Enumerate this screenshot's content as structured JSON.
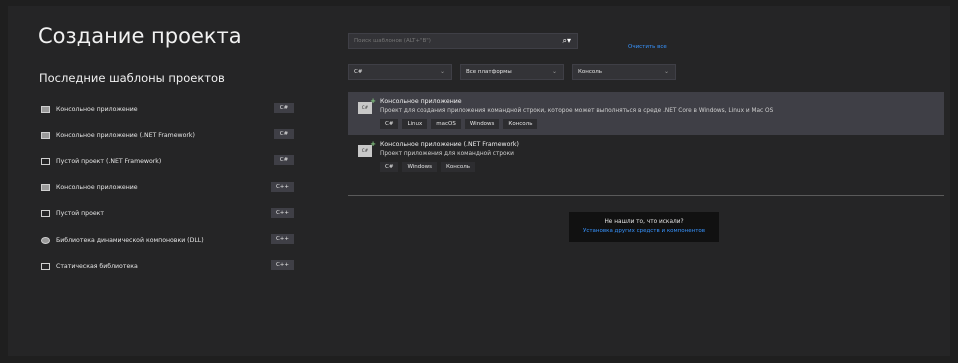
{
  "title": "Создание проекта",
  "recent": {
    "header": "Последние шаблоны проектов",
    "items": [
      {
        "label": "Консольное приложение",
        "tag": "C#",
        "icon": "console-app-icon"
      },
      {
        "label": "Консольное приложение (.NET Framework)",
        "tag": "C#",
        "icon": "console-app-icon"
      },
      {
        "label": "Пустой проект (.NET Framework)",
        "tag": "C#",
        "icon": "empty-project-icon"
      },
      {
        "label": "Консольное приложение",
        "tag": "C++",
        "icon": "console-app-icon"
      },
      {
        "label": "Пустой проект",
        "tag": "C++",
        "icon": "empty-project-icon"
      },
      {
        "label": "Библиотека динамической компоновки (DLL)",
        "tag": "C++",
        "icon": "dll-icon"
      },
      {
        "label": "Статическая библиотека",
        "tag": "C++",
        "icon": "static-library-icon"
      }
    ]
  },
  "search": {
    "placeholder": "Поиск шаблонов (ALT+\"В\")",
    "clear_label": "Очистить все"
  },
  "filters": {
    "language": "C#",
    "platform": "Все платформы",
    "project_type": "Консоль"
  },
  "templates": [
    {
      "name": "Консольное приложение",
      "description": "Проект для создания приложения командной строки, которое может выполняться в среде .NET Core в Windows, Linux и Mac OS",
      "tags": [
        "C#",
        "Linux",
        "macOS",
        "Windows",
        "Консоль"
      ],
      "icon_text": "C#"
    },
    {
      "name": "Консольное приложение (.NET Framework)",
      "description": "Проект приложения для командной строки",
      "tags": [
        "C#",
        "Windows",
        "Консоль"
      ],
      "icon_text": "C#"
    }
  ],
  "not_found": {
    "question": "Не нашли то, что искали?",
    "link": "Установка других средств и компонентов"
  },
  "colors": {
    "background": "#252526",
    "link": "#3794ff",
    "selected": "#3f3f46"
  }
}
